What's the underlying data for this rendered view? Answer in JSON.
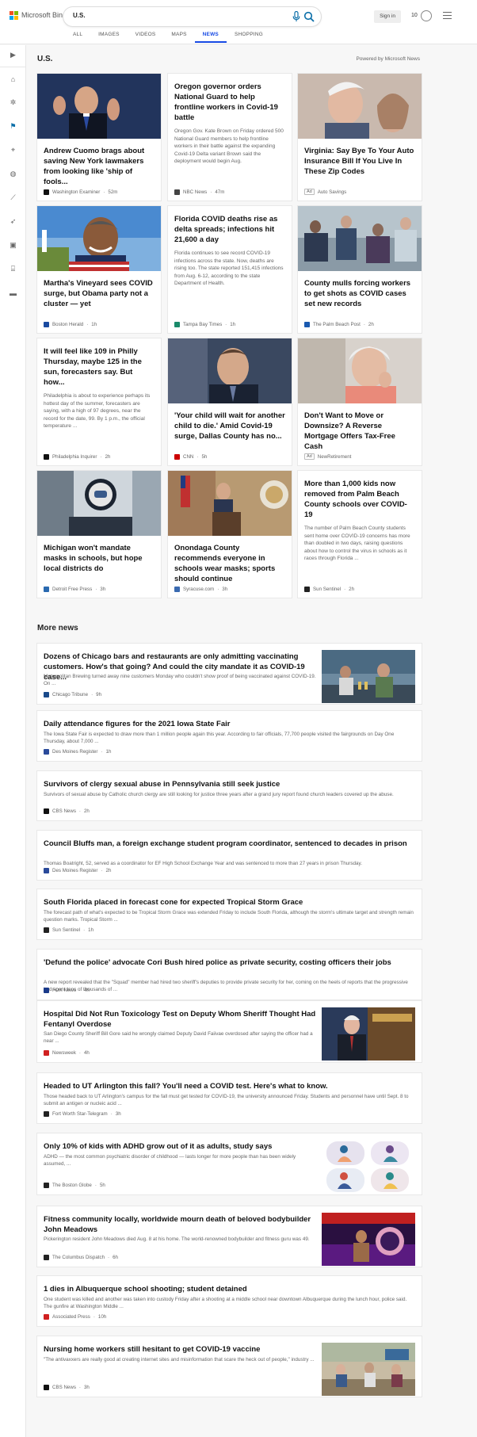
{
  "header": {
    "logo_text": "Microsoft Bing",
    "search_query": "U.S.",
    "signin_label": "Sign in",
    "rewards_count": "10",
    "tabs": [
      "ALL",
      "IMAGES",
      "VIDEOS",
      "MAPS",
      "NEWS",
      "SHOPPING"
    ],
    "active_tab": "NEWS",
    "accent_color": "#174ae4"
  },
  "rail": {
    "icons": [
      "chevron-right-icon",
      "home-icon",
      "coronavirus-icon",
      "flag-icon",
      "location-pin-icon",
      "globe-icon",
      "chart-icon",
      "rocket-icon",
      "film-icon",
      "bank-icon",
      "card-icon"
    ]
  },
  "section": {
    "title": "U.S.",
    "powered_by": "Powered by Microsoft News"
  },
  "cards": [
    {
      "title": "Andrew Cuomo brags about saving New York lawmakers from looking like 'ship of fools...",
      "snippet": "",
      "source": "Washington Examiner",
      "time": "52m",
      "has_image": true,
      "image": "cuomo"
    },
    {
      "title": "Oregon governor orders National Guard to help frontline workers in Covid-19 battle",
      "snippet": "Oregon Gov. Kate Brown on Friday ordered 500 National Guard members to help frontline workers in their battle against the expanding Covid-19 Delta variant Brown said the deployment would begin Aug.",
      "source": "NBC News",
      "time": "47m",
      "has_image": false
    },
    {
      "title": "Virginia: Say Bye To Your Auto Insurance Bill If You Live In These Zip Codes",
      "snippet": "",
      "source": "Auto Savings",
      "time": "",
      "ad": "Ad",
      "has_image": true,
      "image": "oldman"
    },
    {
      "title": "Martha's Vineyard sees COVID surge, but Obama party not a cluster — yet",
      "snippet": "",
      "source": "Boston Herald",
      "time": "1h",
      "has_image": true,
      "image": "obama"
    },
    {
      "title": "Florida COVID deaths rise as delta spreads; infections hit 21,600 a day",
      "snippet": "Florida continues to see record COVID-19 infections across the state. Now, deaths are rising too. The state reported 151,415 infections from Aug. 6-12, according to the state Department of Health.",
      "source": "Tampa Bay Times",
      "time": "1h",
      "has_image": false
    },
    {
      "title": "County mulls forcing workers to get shots as COVID cases set new records",
      "snippet": "",
      "source": "The Palm Beach Post",
      "time": "2h",
      "has_image": true,
      "image": "hospital"
    },
    {
      "title": "It will feel like 109 in Philly Thursday, maybe 125 in the sun, forecasters say. But how...",
      "snippet": "Philadelphia is about to experience perhaps its hottest day of the summer, forecasters are saying, with a high of 97 degrees, near the record for the date, 99. By 1 p.m., the official temperature ...",
      "source": "Philadelphia Inquirer",
      "time": "2h",
      "has_image": false
    },
    {
      "title": "'Your child will wait for another child to die.' Amid Covid-19 surge, Dallas County has no...",
      "snippet": "",
      "source": "CNN",
      "time": "5h",
      "has_image": true,
      "image": "man-suit"
    },
    {
      "title": "Don't Want to Move or Downsize? A Reverse Mortgage Offers Tax-Free Cash",
      "snippet": "",
      "source": "NewRetirement",
      "time": "",
      "ad": "Ad",
      "has_image": true,
      "image": "oldwoman"
    },
    {
      "title": "Michigan won't mandate masks in schools, but hope local districts do",
      "snippet": "",
      "source": "Detroit Free Press",
      "time": "3h",
      "has_image": true,
      "image": "mask-sign"
    },
    {
      "title": "Onondaga County recommends everyone in schools wear masks; sports should continue",
      "snippet": "",
      "source": "Syracuse.com",
      "time": "3h",
      "has_image": true,
      "image": "podium"
    },
    {
      "title": "More than 1,000 kids now removed from Palm Beach County schools over COVID-19",
      "snippet": "The number of Palm Beach County students sent home over COVID-19 concerns has more than doubled in two days, raising questions about how to control the virus in schools as it races through Florida ...",
      "source": "Sun Sentinel",
      "time": "2h",
      "has_image": false
    }
  ],
  "more_news": {
    "title": "More news",
    "items": [
      {
        "title": "Dozens of Chicago bars and restaurants are only admitting vaccinating customers. How's that going? And could the city mandate it as COVID-19 case...",
        "snippet": "Metropolitan Brewing turned away nine customers Monday who couldn't show proof of being vaccinated against COVID-19. On ...",
        "source": "Chicago Tribune",
        "time": "9h",
        "image": "bar"
      },
      {
        "title": "Daily attendance figures for the 2021 Iowa State Fair",
        "snippet": "The Iowa State Fair is expected to draw more than 1 million people again this year. According to fair officials, 77,700 people visited the fairgrounds on Day One Thursday, about 7,000 ...",
        "source": "Des Moines Register",
        "time": "1h",
        "image": ""
      },
      {
        "title": "Survivors of clergy sexual abuse in Pennsylvania still seek justice",
        "snippet": "Survivors of sexual abuse by Catholic church clergy are still looking for justice three years after a grand jury report found church leaders covered up the abuse.",
        "source": "CBS News",
        "time": "2h",
        "image": ""
      },
      {
        "title": "Council Bluffs man, a foreign exchange student program coordinator, sentenced to decades in prison",
        "snippet": "Thomas Boatright, 52, served as a coordinator for EF High School Exchange Year and was sentenced to more than 27 years in prison Thursday.",
        "source": "Des Moines Register",
        "time": "2h",
        "image": ""
      },
      {
        "title": "South Florida placed in forecast cone for expected Tropical Storm Grace",
        "snippet": "The forecast path of what's expected to be Tropical Storm Grace was extended Friday to include South Florida, although the storm's ultimate target and strength remain question marks. Tropical Storm ...",
        "source": "Sun Sentinel",
        "time": "1h",
        "image": ""
      },
      {
        "title": "'Defund the police' advocate Cori Bush hired police as private security, costing officers their jobs",
        "snippet": "A new report revealed that the \"Squad\" member had hired two sheriff's deputies to provide private security for her, coming on the heels of reports that the progressive had spent tens of thousands of ...",
        "source": "FOX News",
        "time": "4h",
        "image": ""
      },
      {
        "title": "Hospital Did Not Run Toxicology Test on Deputy Whom Sheriff Thought Had Fentanyl Overdose",
        "snippet": "San Diego County Sheriff Bill Gore said he wrongly claimed Deputy David Faiivae overdosed after saying the officer had a near ...",
        "source": "Newsweek",
        "time": "4h",
        "image": "sheriff"
      },
      {
        "title": "Headed to UT Arlington this fall? You'll need a COVID test. Here's what to know.",
        "snippet": "Those headed back to UT Arlington's campus for the fall must get tested for COVID-19, the university announced Friday. Students and personnel have until Sept. 8 to submit an antigen or nucleic acid ...",
        "source": "Fort Worth Star-Telegram",
        "time": "3h",
        "image": ""
      },
      {
        "title": "Only 10% of kids with ADHD grow out of it as adults, study says",
        "snippet": "ADHD — the most common psychiatric disorder of childhood — lasts longer for more people than has been widely assumed, ...",
        "source": "The Boston Globe",
        "time": "5h",
        "image": "adhd"
      },
      {
        "title": "Fitness community locally, worldwide mourn death of beloved bodybuilder John Meadows",
        "snippet": "Pickerington resident John Meadows died Aug. 8 at his home. The world-renowned bodybuilder and fitness guru was 49.",
        "source": "The Columbus Dispatch",
        "time": "6h",
        "image": "stage"
      },
      {
        "title": "1 dies in Albuquerque school shooting; student detained",
        "snippet": "One student was killed and another was taken into custody Friday after a shooting at a middle school near downtown Albuquerque during the lunch hour, police said. The gunfire at Washington Middle ...",
        "source": "Associated Press",
        "time": "10h",
        "image": ""
      },
      {
        "title": "Nursing home workers still hesitant to get COVID-19 vaccine",
        "snippet": "\"The antivaxxers are really good at creating internet sites and misinformation that scare the heck out of people,\" industry ...",
        "source": "CBS News",
        "time": "3h",
        "image": "nursing"
      }
    ]
  }
}
